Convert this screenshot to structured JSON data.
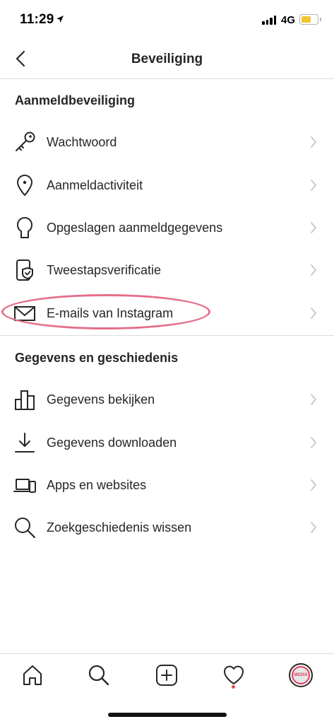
{
  "status_bar": {
    "time": "11:29",
    "network": "4G"
  },
  "nav": {
    "title": "Beveiliging"
  },
  "sections": [
    {
      "header": "Aanmeldbeveiliging",
      "items": [
        {
          "label": "Wachtwoord",
          "icon": "key-icon"
        },
        {
          "label": "Aanmeldactiviteit",
          "icon": "location-pin-icon"
        },
        {
          "label": "Opgeslagen aanmeldgegevens",
          "icon": "keyhole-icon"
        },
        {
          "label": "Tweestapsverificatie",
          "icon": "phone-shield-icon"
        },
        {
          "label": "E-mails van Instagram",
          "icon": "mail-icon"
        }
      ]
    },
    {
      "header": "Gegevens en geschiedenis",
      "items": [
        {
          "label": "Gegevens bekijken",
          "icon": "bar-chart-icon"
        },
        {
          "label": "Gegevens downloaden",
          "icon": "download-icon"
        },
        {
          "label": "Apps en websites",
          "icon": "devices-icon"
        },
        {
          "label": "Zoekgeschiedenis wissen",
          "icon": "search-icon"
        }
      ]
    }
  ],
  "avatar_text": "MEDIA",
  "colors": {
    "highlight": "#e56e8a",
    "notification": "#ed4956",
    "battery": "#f4c430"
  }
}
